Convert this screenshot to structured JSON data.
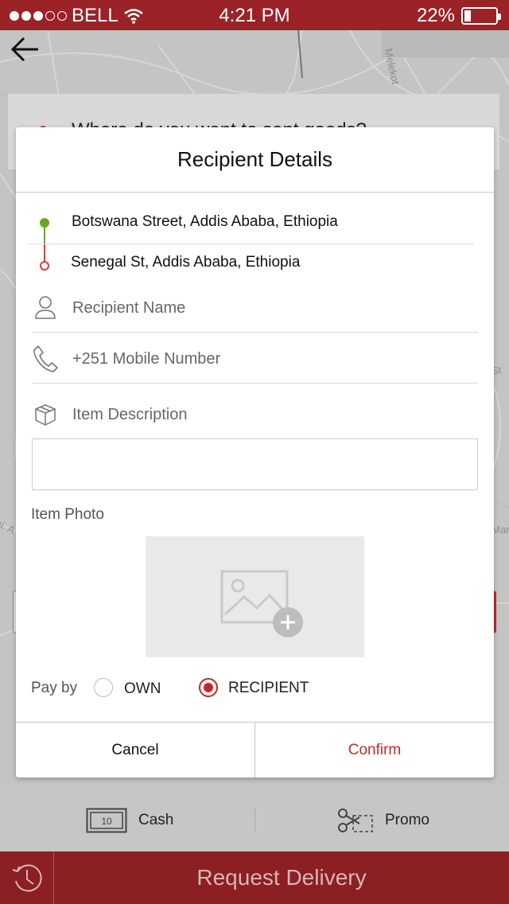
{
  "status_bar": {
    "carrier": "BELL",
    "time": "4:21 PM",
    "battery": "22%",
    "battery_level": 0.22
  },
  "map": {
    "street_labels": [
      "Melekot",
      "St",
      "Mar",
      "ei. A"
    ]
  },
  "background_search": {
    "placeholder": "Where do you want to sent goods?"
  },
  "modal": {
    "title": "Recipient Details",
    "pickup_address": "Botswana Street, Addis Ababa, Ethiopia",
    "dropoff_address": "Senegal St, Addis Ababa, Ethiopia",
    "recipient_name_placeholder": "Recipient Name",
    "mobile_placeholder": "+251 Mobile Number",
    "item_description_label": "Item Description",
    "item_description_value": "",
    "item_photo_label": "Item Photo",
    "pay_by_label": "Pay by",
    "pay_options": [
      {
        "label": "OWN",
        "selected": false
      },
      {
        "label": "RECIPIENT",
        "selected": true
      }
    ],
    "cancel_label": "Cancel",
    "confirm_label": "Confirm"
  },
  "payment_row": {
    "cash_label": "Cash",
    "promo_label": "Promo",
    "cash_icon_text": "10"
  },
  "request_button": {
    "label": "Request Delivery"
  },
  "colors": {
    "brand": "#9b2226",
    "accent": "#c62828",
    "pickup_dot": "#6aaa1f",
    "dropoff_dot": "#e53935"
  },
  "icons": [
    "back-arrow-icon",
    "wifi-icon",
    "battery-icon",
    "person-icon",
    "phone-icon",
    "package-icon",
    "image-icon",
    "add-photo-icon",
    "cash-icon",
    "scissors-icon",
    "history-icon"
  ]
}
